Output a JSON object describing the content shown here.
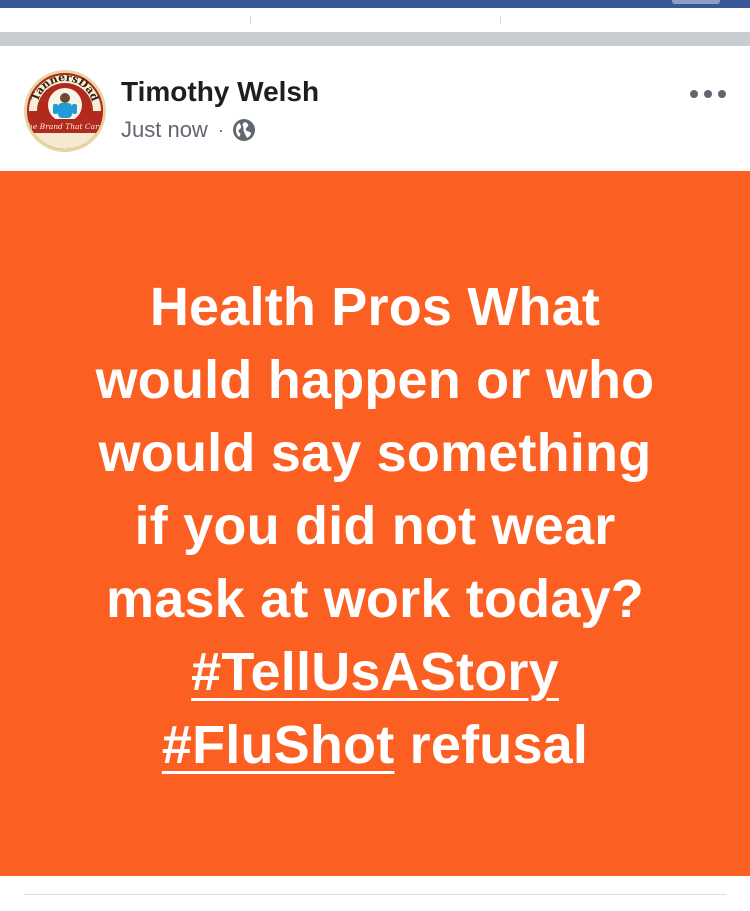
{
  "post": {
    "author_name": "Timothy Welsh",
    "timestamp": "Just now",
    "separator": "·",
    "audience_icon": "globe-icon",
    "more_icon": "more-options-icon",
    "avatar": {
      "logo_top_text": "TannersDad",
      "logo_bottom_text": "The Brand That Cares"
    },
    "status": {
      "background_color": "#fb6022",
      "text_color": "#ffffff",
      "lines": [
        "Health Pros What",
        "would happen or who",
        "would say something",
        "if you did not wear",
        "mask at work today?"
      ],
      "hashtag_1": "#TellUsAStory",
      "hashtag_2": "#FluShot",
      "trailing_text": " refusal"
    }
  },
  "colors": {
    "brand_blue": "#3b5998",
    "feed_gap": "#c9ccd1",
    "secondary_text": "#606770",
    "primary_text": "#1c1e21"
  }
}
